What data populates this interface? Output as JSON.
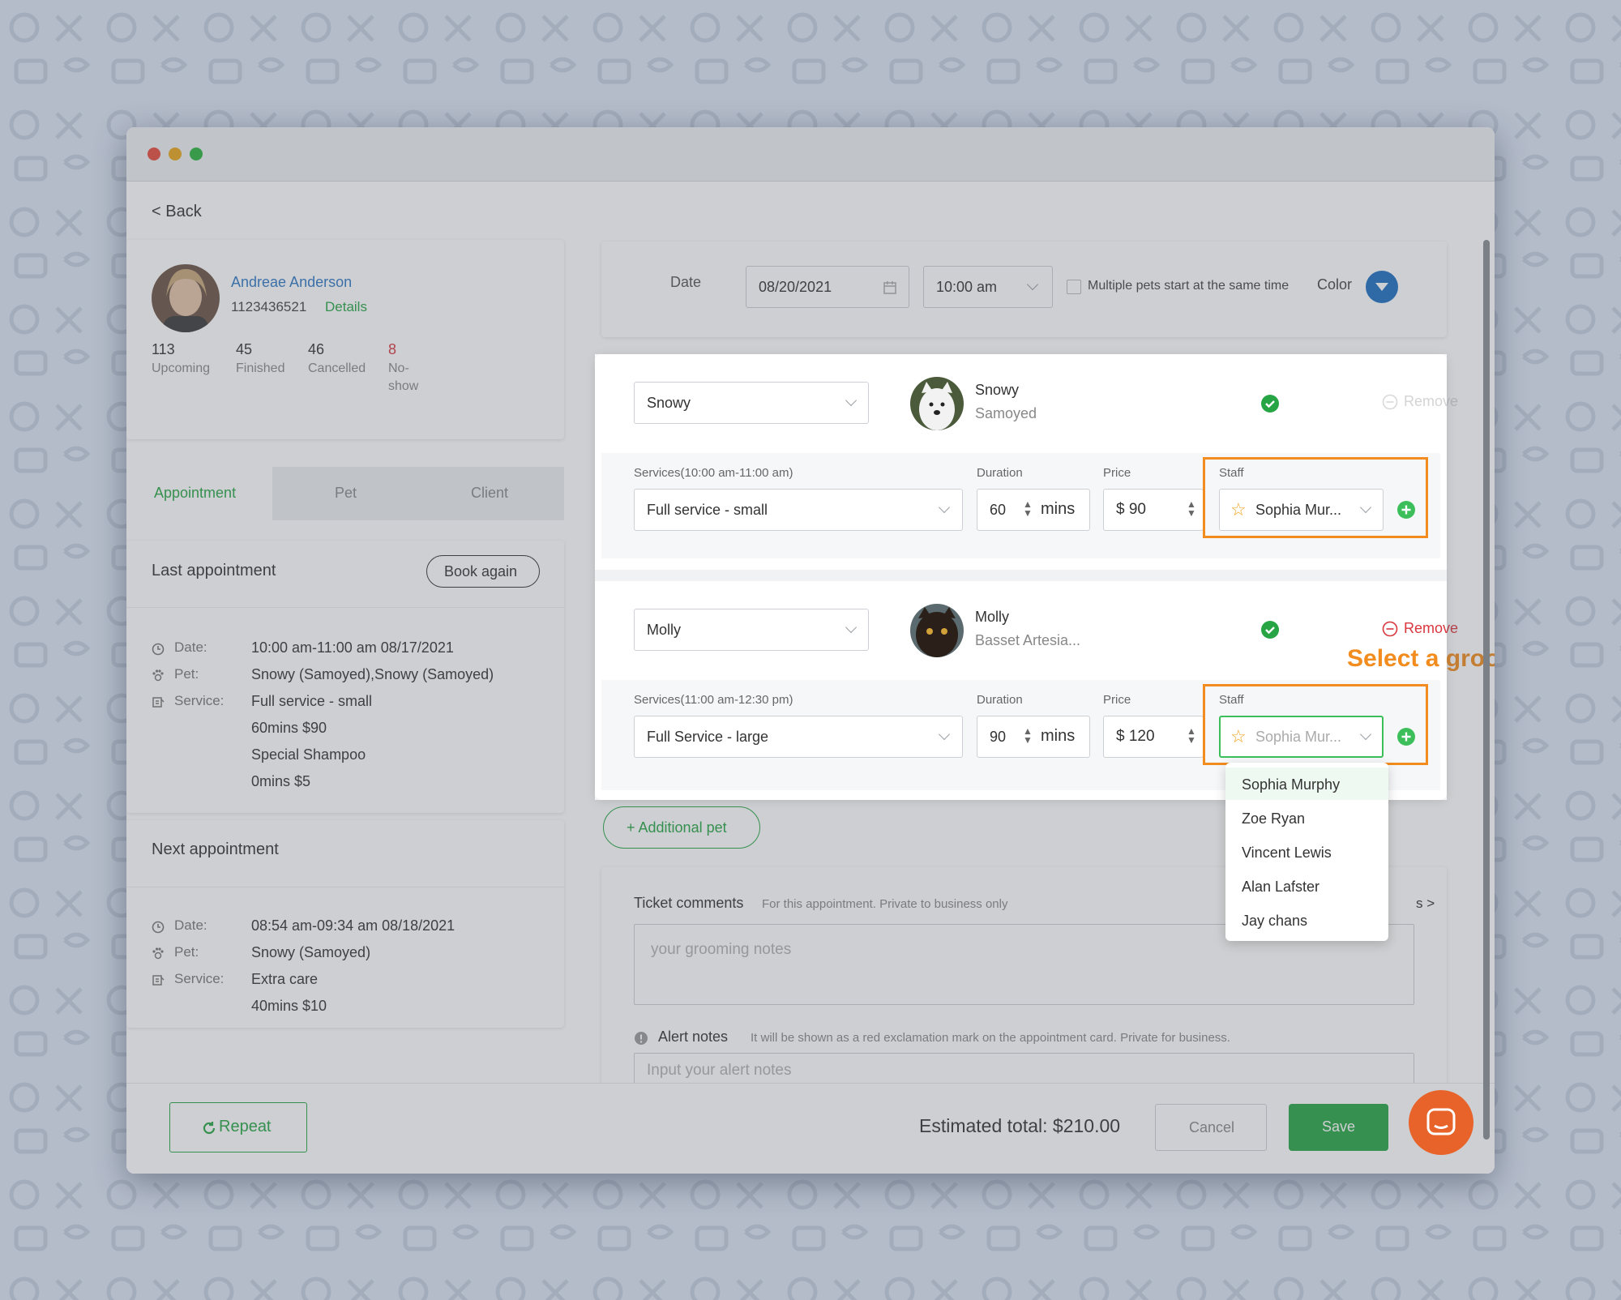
{
  "window": {
    "colors": {
      "close": "#e64b3c",
      "minimize": "#e9a51a",
      "maximize": "#2db33e"
    }
  },
  "nav": {
    "back": "< Back"
  },
  "client": {
    "name": "Andreae Anderson",
    "phone": "1123436521",
    "details_link": "Details",
    "stats": [
      {
        "value": "113",
        "label": "Upcoming"
      },
      {
        "value": "45",
        "label": "Finished"
      },
      {
        "value": "46",
        "label": "Cancelled"
      },
      {
        "value": "8",
        "label_line1": "No-",
        "label_line2": "show"
      }
    ]
  },
  "tabs": [
    "Appointment",
    "Pet",
    "Client"
  ],
  "last_appointment": {
    "heading": "Last appointment",
    "book_again": "Book again",
    "date_label": "Date:",
    "date_value": "10:00 am-11:00 am 08/17/2021",
    "pet_label": "Pet:",
    "pet_value": "Snowy (Samoyed),Snowy (Samoyed)",
    "service_label": "Service:",
    "service_lines": [
      "Full service - small",
      "60mins  $90",
      "Special Shampoo",
      "0mins  $5"
    ]
  },
  "next_appointment": {
    "heading": "Next appointment",
    "date_label": "Date:",
    "date_value": "08:54 am-09:34 am 08/18/2021",
    "pet_label": "Pet:",
    "pet_value": "Snowy (Samoyed)",
    "service_label": "Service:",
    "service_lines": [
      "Extra care",
      "40mins  $10"
    ]
  },
  "booking": {
    "date_label": "Date",
    "date_value": "08/20/2021",
    "time_value": "10:00 am",
    "multi_pets_label": "Multiple pets start at the same time",
    "color_label": "Color",
    "color_value": "#1f6fc0"
  },
  "pets": [
    {
      "select_value": "Snowy",
      "name": "Snowy",
      "breed": "Samoyed",
      "remove": "Remove",
      "services_label": "Services(10:00 am-11:00 am)",
      "service_value": "Full service - small",
      "duration_label": "Duration",
      "duration_value": "60",
      "duration_unit": "mins",
      "price_label": "Price",
      "price_value": "$ 90",
      "staff_label": "Staff",
      "staff_value": "Sophia Mur..."
    },
    {
      "select_value": "Molly",
      "name": "Molly",
      "breed": "Basset Artesia...",
      "remove": "Remove",
      "services_label": "Services(11:00 am-12:30 pm)",
      "service_value": "Full Service - large",
      "duration_label": "Duration",
      "duration_value": "90",
      "duration_unit": "mins",
      "price_label": "Price",
      "price_value": "$ 120",
      "staff_label": "Staff",
      "staff_value": "Sophia Mur..."
    }
  ],
  "callout": "Select a groomer",
  "staff_dropdown": [
    "Sophia Murphy",
    "Zoe Ryan",
    "Vincent Lewis",
    "Alan Lafster",
    "Jay chans"
  ],
  "additional_pet": "+ Additional pet",
  "ticket_comments": {
    "label": "Ticket comments",
    "hint": "For this appointment. Private to business only",
    "link_fragment": "s >",
    "placeholder": "your grooming notes"
  },
  "alert_notes": {
    "label": "Alert notes",
    "hint": "It will be shown as a red exclamation mark on the appointment card. Private for business.",
    "placeholder": "Input your alert notes"
  },
  "footer": {
    "repeat": "Repeat",
    "estimated_total": "Estimated total: $210.00",
    "cancel": "Cancel",
    "save": "Save"
  },
  "accent_colors": {
    "green": "#27a544",
    "orange": "#f28c1e",
    "red": "#d9363e",
    "link_blue": "#2f78c4"
  },
  "icons": [
    "calendar-icon",
    "clock-icon",
    "paw-icon",
    "service-icon",
    "check-circle-icon",
    "remove-circle-icon",
    "star-icon",
    "plus-circle-icon",
    "refresh-icon",
    "alert-icon",
    "chat-icon"
  ]
}
